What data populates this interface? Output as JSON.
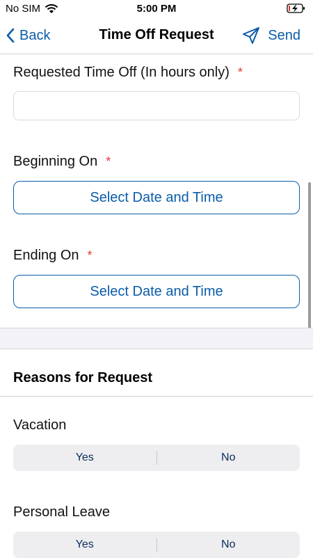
{
  "status_bar": {
    "carrier": "No SIM",
    "time": "5:00 PM"
  },
  "nav": {
    "back_label": "Back",
    "title": "Time Off Request",
    "send_label": "Send"
  },
  "form": {
    "requested_label": "Requested Time Off (In hours only)",
    "required_mark": "*",
    "requested_value": "",
    "beginning_label": "Beginning On",
    "beginning_button": "Select Date and Time",
    "ending_label": "Ending On",
    "ending_button": "Select Date and Time"
  },
  "reasons": {
    "header": "Reasons for Request",
    "vacation": {
      "label": "Vacation",
      "yes": "Yes",
      "no": "No"
    },
    "personal_leave": {
      "label": "Personal Leave",
      "yes": "Yes",
      "no": "No"
    }
  },
  "colors": {
    "accent": "#0a5ca8",
    "required": "#e53935",
    "section_bg": "#f2f2f7"
  }
}
